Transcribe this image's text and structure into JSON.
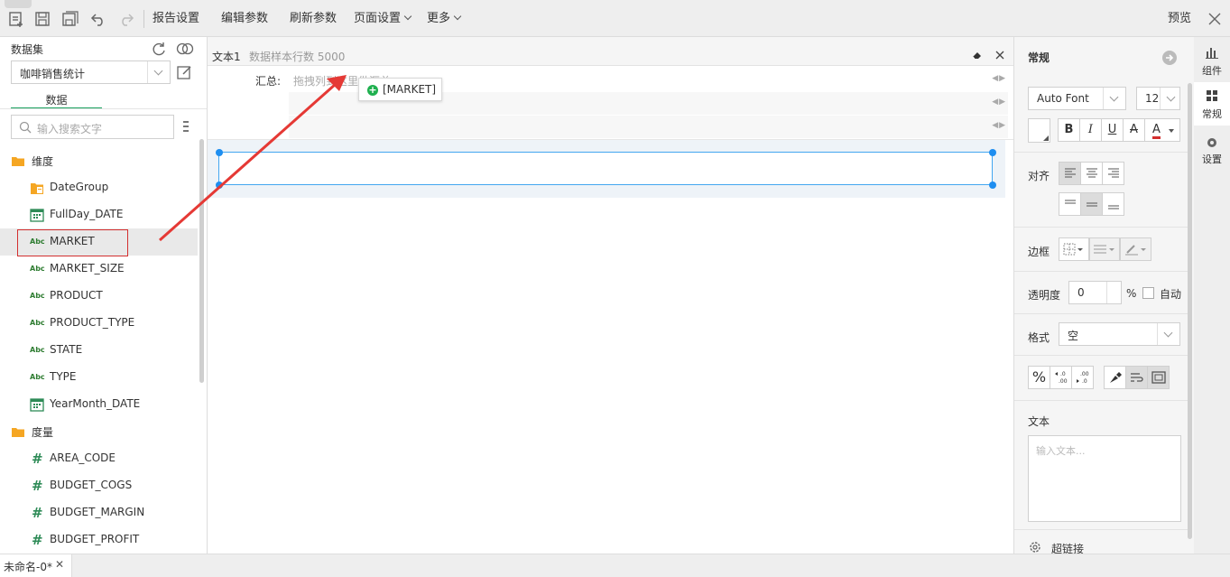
{
  "toolbar": {
    "menus": [
      "报告设置",
      "编辑参数",
      "刷新参数",
      "页面设置",
      "更多"
    ],
    "preview": "预览"
  },
  "left": {
    "dataset_title": "数据集",
    "dataset_value": "咖啡销售统计",
    "tab": "数据",
    "search_placeholder": "输入搜索文字",
    "dimension_folder": "维度",
    "dimensions": [
      {
        "label": "DateGroup",
        "icon": "date-group-icon"
      },
      {
        "label": "FullDay_DATE",
        "icon": "calendar-icon"
      },
      {
        "label": "MARKET",
        "icon": "abc-icon"
      },
      {
        "label": "MARKET_SIZE",
        "icon": "abc-icon"
      },
      {
        "label": "PRODUCT",
        "icon": "abc-icon"
      },
      {
        "label": "PRODUCT_TYPE",
        "icon": "abc-icon"
      },
      {
        "label": "STATE",
        "icon": "abc-icon"
      },
      {
        "label": "TYPE",
        "icon": "abc-icon"
      },
      {
        "label": "YearMonth_DATE",
        "icon": "calendar-icon"
      }
    ],
    "measure_folder": "度量",
    "measures": [
      "AREA_CODE",
      "BUDGET_COGS",
      "BUDGET_MARGIN",
      "BUDGET_PROFIT"
    ],
    "abc_text": "Abc",
    "hash_text": "#"
  },
  "center": {
    "component_name": "文本1",
    "sample_rows": "数据样本行数 5000",
    "summary_label": "汇总:",
    "summary_placeholder": "拖拽列到这里做汇总",
    "drag_tip": "[MARKET]"
  },
  "right": {
    "title": "常规",
    "font": "Auto Font",
    "font_size": "12",
    "bold": "B",
    "italic": "I",
    "underline": "U",
    "strike": "A",
    "font_color": "A",
    "align_label": "对齐",
    "border_label": "边框",
    "opacity_label": "透明度",
    "opacity_value": "0",
    "percent": "%",
    "auto_label": "自动",
    "format_label": "格式",
    "format_value": "空",
    "percent_btn": "%",
    "text_label": "文本",
    "text_placeholder": "输入文本...",
    "hyperlink_label": "超链接"
  },
  "far_right": {
    "items": [
      "组件",
      "常规",
      "设置"
    ]
  },
  "bottom": {
    "tab": "未命名-0*"
  },
  "colors": {
    "accent": "#1aa15f",
    "selection": "#43a6f0",
    "arrow": "#e53935"
  }
}
